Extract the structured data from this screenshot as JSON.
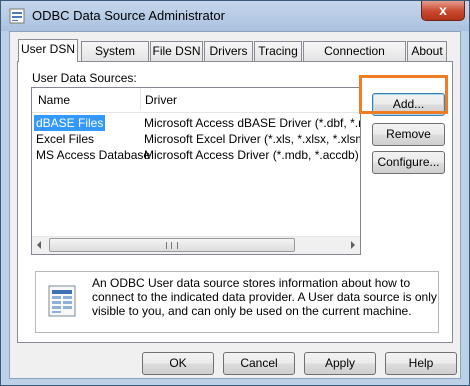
{
  "window": {
    "title": "ODBC Data Source Administrator",
    "close_glyph": "x"
  },
  "tabs": [
    {
      "label": "User DSN",
      "active": true
    },
    {
      "label": "System DSN"
    },
    {
      "label": "File DSN"
    },
    {
      "label": "Drivers"
    },
    {
      "label": "Tracing"
    },
    {
      "label": "Connection Pooling"
    },
    {
      "label": "About"
    }
  ],
  "user_data_sources_label": "User Data Sources:",
  "list": {
    "columns": [
      "Name",
      "Driver"
    ],
    "rows": [
      {
        "name": "dBASE Files",
        "driver": "Microsoft Access dBASE Driver (*.dbf, *.ndx",
        "selected": true
      },
      {
        "name": "Excel Files",
        "driver": "Microsoft Excel Driver (*.xls, *.xlsx, *.xlsm, *.x"
      },
      {
        "name": "MS Access Database",
        "driver": "Microsoft Access Driver (*.mdb, *.accdb)"
      }
    ]
  },
  "side_buttons": {
    "add": "Add...",
    "remove": "Remove",
    "configure": "Configure..."
  },
  "info": {
    "icon": "data-source-document-icon",
    "text": "An ODBC User data source stores information about how to connect to the indicated data provider.  A User data source is only visible to you, and can only be used on the current machine."
  },
  "bottom_buttons": {
    "ok": "OK",
    "cancel": "Cancel",
    "apply": "Apply",
    "help": "Help"
  },
  "colors": {
    "highlight": "#f07c24",
    "selection": "#3399ff"
  }
}
